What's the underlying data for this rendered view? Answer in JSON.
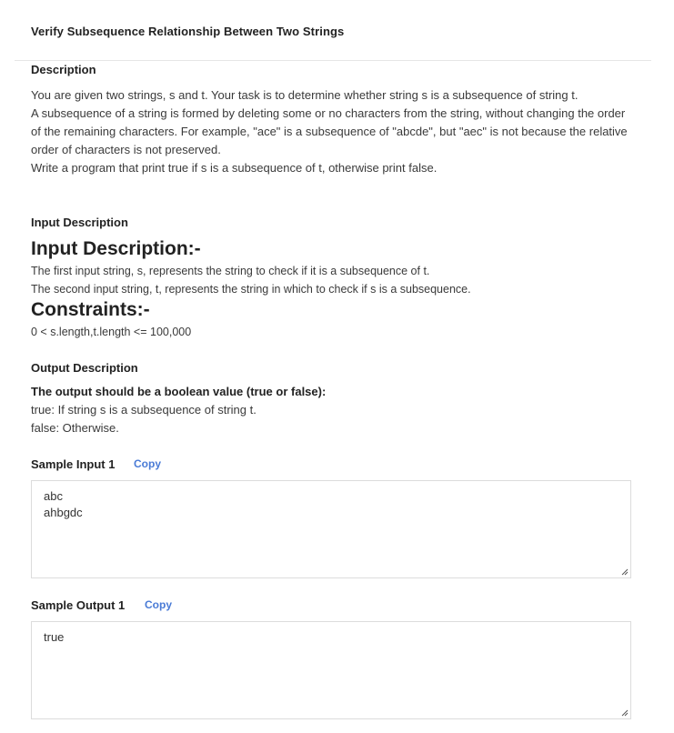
{
  "page_title": "Verify Subsequence Relationship Between Two Strings",
  "description": {
    "heading": "Description",
    "lines": [
      "You are given two strings, s and t. Your task is to determine whether string s is a subsequence of string t.",
      "A subsequence of a string is formed by deleting some or no characters from the string, without changing the order of the remaining characters. For example, \"ace\" is a subsequence of \"abcde\", but \"aec\" is not because the relative order of characters is not preserved.",
      "Write a program that print true if s is a subsequence of t, otherwise print false."
    ]
  },
  "input_description": {
    "heading": "Input Description",
    "big_heading": "Input Description:-",
    "lines": [
      "The first input string, s, represents the string to check if it is a subsequence of t.",
      "The second input string, t, represents the string in which to check if s is a subsequence."
    ],
    "constraints_heading": "Constraints:-",
    "constraints_text": "0 < s.length,t.length <= 100,000"
  },
  "output_description": {
    "heading": "Output Description",
    "bold_line": "The output should be a boolean value (true or false):",
    "lines": [
      "true: If string s is a subsequence of string t.",
      "false: Otherwise."
    ]
  },
  "sample_input": {
    "label": "Sample Input 1",
    "copy_label": "Copy",
    "value": "abc\nahbgdc"
  },
  "sample_output": {
    "label": "Sample Output 1",
    "copy_label": "Copy",
    "value": "true"
  },
  "colors": {
    "link": "#4a7bd6",
    "border": "#dcdcdc",
    "text": "#3a3a3a",
    "heading": "#222222"
  },
  "icons": {
    "resize": "resize-grip-icon"
  }
}
